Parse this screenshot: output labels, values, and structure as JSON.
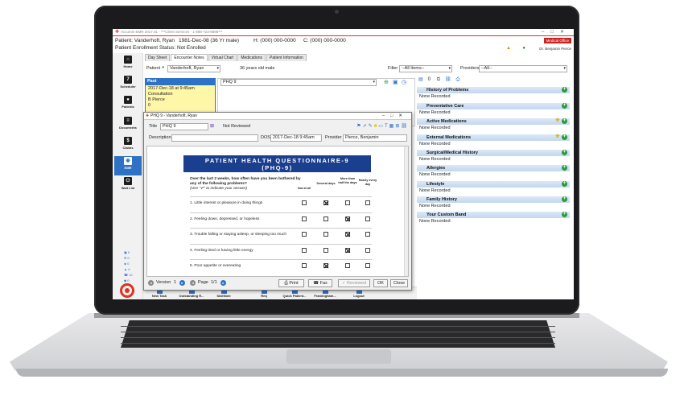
{
  "app": {
    "title": "Accumin EMR 2017.01 - ***Client Services - 1-888-723-8888***",
    "badge": "Medical Office",
    "user": "Dr. Benjamin Pierce"
  },
  "patient": {
    "name_line": "Patient: Vanderhoft, Ryan",
    "dob": "1981-Dec-08 (36 Yr male)",
    "home": "H: (000) 000-0000",
    "cell": "C: (000) 000-0000",
    "enrollment": "Patient Enrollment Status: Not Enrolled"
  },
  "leftnav": [
    {
      "label": "Home",
      "icon": "home-icon",
      "glyph": "⌂"
    },
    {
      "label": "Scheduler",
      "icon": "calendar-icon",
      "glyph": "7"
    },
    {
      "label": "Patients",
      "icon": "person-icon",
      "glyph": "●"
    },
    {
      "label": "Documents",
      "icon": "document-icon",
      "glyph": "≡"
    },
    {
      "label": "Claims",
      "icon": "claims-icon",
      "glyph": "$"
    },
    {
      "label": "EMR",
      "icon": "camera-icon",
      "glyph": "◉"
    },
    {
      "label": "Wait List",
      "icon": "waitlist-icon",
      "glyph": "⚇"
    }
  ],
  "navstats": [
    "0",
    "0",
    "0",
    "4",
    "12",
    "0"
  ],
  "tabs": [
    "Day Sheet",
    "Encounter Notes",
    "Virtual Chart",
    "Medications",
    "Patient Information"
  ],
  "toprow": {
    "patient_label": "Patient",
    "patient_value": "Vanderhoft, Ryan",
    "age": "36 years old male",
    "filter_label": "Filter",
    "filter_value": "--All Items--",
    "providers_label": "Providers",
    "providers_value": "--All--"
  },
  "past": {
    "header": "Past",
    "lines": [
      "2017-Dec-18 at 9:45am",
      "Consultation",
      "B Pierce",
      "0"
    ]
  },
  "center": {
    "form_select": "PHQ 9"
  },
  "right": {
    "count": "0",
    "sections": [
      {
        "title": "History of Problems",
        "none": "None Recorded"
      },
      {
        "title": "Preventative Care",
        "none": "None Recorded"
      },
      {
        "title": "Active Medications",
        "none": "None Recorded"
      },
      {
        "title": "External Medications",
        "none": "None Recorded"
      },
      {
        "title": "Surgical/Medical History",
        "none": "None Recorded"
      },
      {
        "title": "Allergies",
        "none": "None Recorded"
      },
      {
        "title": "Lifestyle",
        "none": "None Recorded"
      },
      {
        "title": "Family History",
        "none": "None Recorded"
      },
      {
        "title": "Your Custom Band",
        "none": "None Recorded"
      }
    ]
  },
  "bottombar": [
    "New Task",
    "Outstanding R...",
    "SideNote",
    "Req",
    "Quick Patient...",
    "Framingham...",
    "Logout"
  ],
  "modal": {
    "title": "PHQ 9 - Vanderhoft, Ryan",
    "title_label": "Title",
    "title_value": "PHQ 9",
    "status": "Not Reviewed",
    "description_label": "Description",
    "dos_label": "DOS",
    "dos_value": "2017-Dec-18 9:45am",
    "provider_label": "Provider",
    "provider_value": "Pierce, Benjamin",
    "banner_line1": "PATIENT HEALTH QUESTIONNAIRE-9",
    "banner_line2": "(PHQ-9)",
    "intro": "Over the last 2 weeks, how often have you been bothered by any of the following problems?",
    "intro_sub": "(Use \"✔\" to indicate your answer)",
    "columns": [
      "Not at all",
      "Several days",
      "More than half the days",
      "Nearly every day"
    ],
    "questions": [
      {
        "text": "1. Little interest or pleasure in doing things",
        "answer": 1
      },
      {
        "text": "2. Feeling down, depressed, or hopeless",
        "answer": 2
      },
      {
        "text": "3. Trouble falling or staying asleep, or sleeping too much",
        "answer": 2
      },
      {
        "text": "4. Feeling tired or having little energy",
        "answer": 2
      },
      {
        "text": "5. Poor appetite or overeating",
        "answer": 1
      }
    ],
    "footer": {
      "version_label": "Version",
      "version_value": "1",
      "page_label": "Page",
      "page_value": "1/1",
      "print": "Print",
      "fax": "Fax",
      "reviewed": "Reviewed",
      "ok": "OK",
      "close": "Close"
    }
  }
}
